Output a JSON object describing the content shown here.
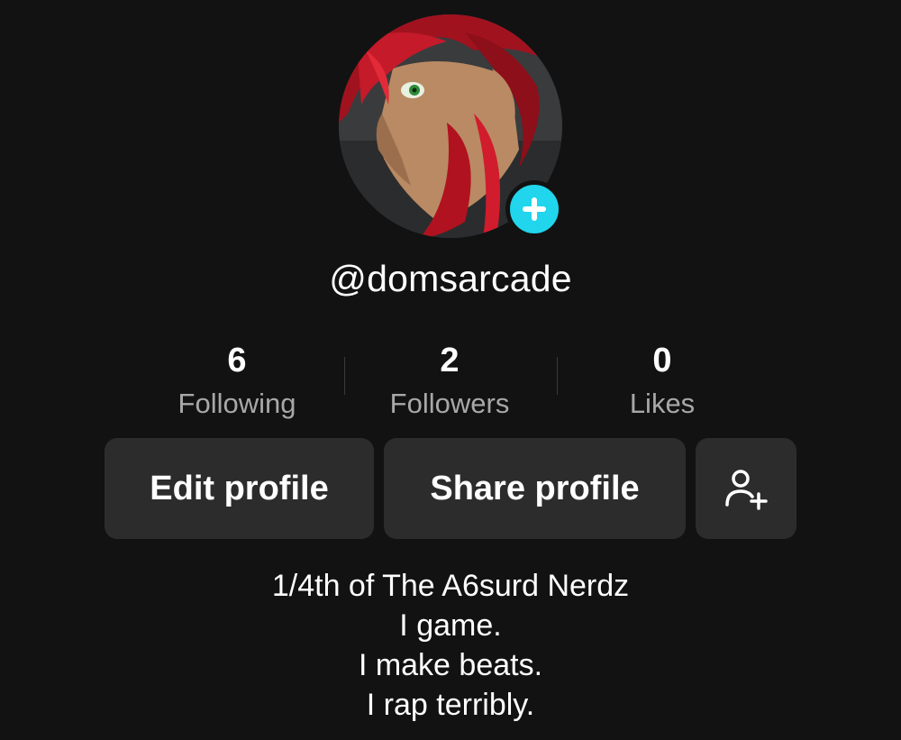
{
  "profile": {
    "username": "@domsarcade",
    "avatar_icon": "anime-avatar-image",
    "add_badge_icon": "plus-icon",
    "accent_color": "#20d5ec"
  },
  "stats": [
    {
      "count": "6",
      "label": "Following"
    },
    {
      "count": "2",
      "label": "Followers"
    },
    {
      "count": "0",
      "label": "Likes"
    }
  ],
  "actions": {
    "edit_label": "Edit profile",
    "share_label": "Share profile",
    "add_friend_icon": "add-friend-icon"
  },
  "bio": [
    "1/4th of The A6surd Nerdz",
    "I game.",
    "I make beats.",
    "I rap terribly."
  ]
}
